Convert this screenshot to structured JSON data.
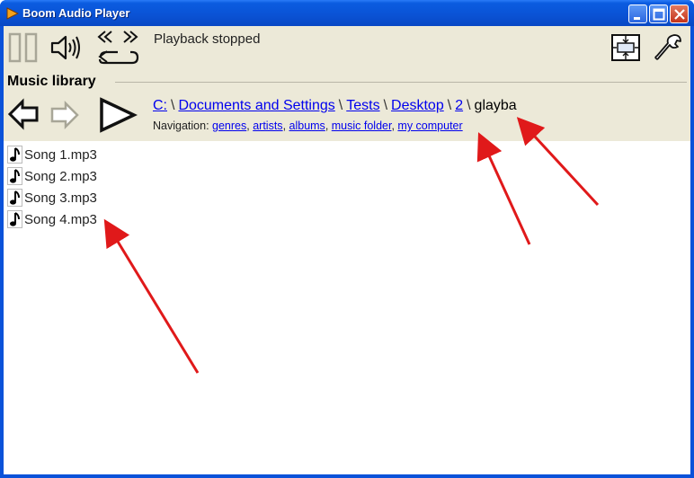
{
  "window": {
    "title": "Boom Audio Player",
    "title_bar_color": "#0a52d9",
    "buttons": [
      "minimize",
      "maximize",
      "close"
    ]
  },
  "toolbar": {
    "status": "Playback stopped",
    "icons": [
      "pause-icon",
      "volume-icon",
      "repeat-icon",
      "resize-icon",
      "settings-wrench-icon"
    ]
  },
  "library": {
    "title": "Music library",
    "nav_buttons": [
      "back-arrow-icon",
      "forward-arrow-icon",
      "play-icon"
    ],
    "breadcrumb": {
      "items": [
        {
          "label": "C:",
          "link": true
        },
        {
          "label": "Documents and Settings",
          "link": true
        },
        {
          "label": "Tests",
          "link": true
        },
        {
          "label": "Desktop",
          "link": true
        },
        {
          "label": "2",
          "link": true
        },
        {
          "label": "glayba",
          "link": false
        }
      ],
      "separator": "\\"
    },
    "navigation": {
      "label": "Navigation:",
      "links": [
        "genres",
        "artists",
        "albums",
        "music folder",
        "my computer"
      ]
    }
  },
  "songs": [
    {
      "name": "Song 1.mp3"
    },
    {
      "name": "Song 2.mp3"
    },
    {
      "name": "Song 3.mp3"
    },
    {
      "name": "Song 4.mp3"
    }
  ],
  "colors": {
    "link": "#0000ee",
    "panel": "#ece9d8",
    "annotation_arrow": "#e0191a"
  }
}
